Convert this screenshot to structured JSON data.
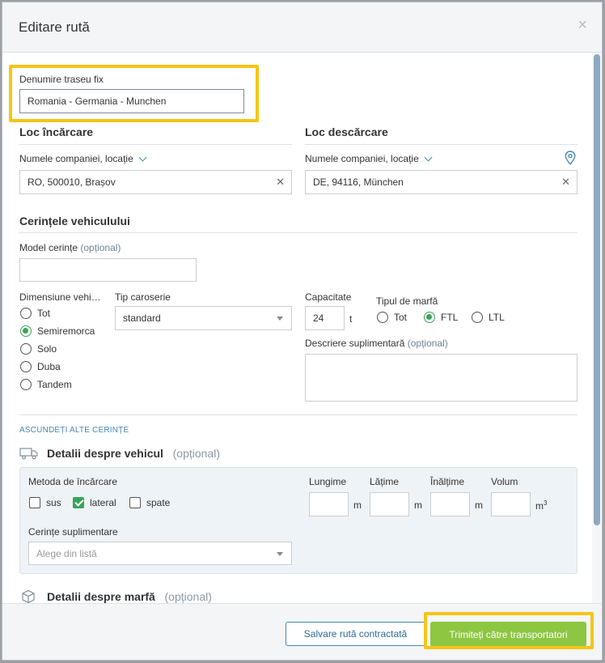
{
  "modal": {
    "title": "Editare rută",
    "close_label": "×"
  },
  "route_name": {
    "label": "Denumire traseu fix",
    "value": "Romania - Germania - Munchen"
  },
  "loading": {
    "title": "Loc încărcare",
    "dropdown_label": "Numele companiei, locație",
    "value": "RO, 500010, Brașov"
  },
  "unloading": {
    "title": "Loc descărcare",
    "dropdown_label": "Numele companiei, locație",
    "value": "DE, 94116, München"
  },
  "vehicle_requirements": {
    "title": "Cerințele vehiculului",
    "model_label": "Model cerințe",
    "model_optional": "(opțional)",
    "model_value": "",
    "dimension_label": "Dimensiune vehi…",
    "dimension_options": [
      "Tot",
      "Semiremorca",
      "Solo",
      "Duba",
      "Tandem"
    ],
    "dimension_selected": "Semiremorca",
    "body_label": "Tip caroserie",
    "body_value": "standard",
    "capacity_label": "Capacitate",
    "capacity_value": "24",
    "capacity_unit": "t",
    "cargo_type_label": "Tipul de marfă",
    "cargo_type_options": [
      "Tot",
      "FTL",
      "LTL"
    ],
    "cargo_type_selected": "FTL",
    "extra_desc_label": "Descriere suplimentară",
    "extra_desc_optional": "(opțional)",
    "extra_desc_value": ""
  },
  "hide_more_link": "ASCUNDEȚI ALTE CERINȚE",
  "vehicle_details": {
    "title": "Detalii despre vehicul",
    "optional": "(opțional)",
    "loading_method_label": "Metoda de încărcare",
    "loading_methods": [
      {
        "label": "sus",
        "checked": false
      },
      {
        "label": "lateral",
        "checked": true
      },
      {
        "label": "spate",
        "checked": false
      }
    ],
    "length_label": "Lungime",
    "width_label": "Lățime",
    "height_label": "Înălțime",
    "volume_label": "Volum",
    "unit_m": "m",
    "unit_m3": "m",
    "unit_m3_sup": "3",
    "extra_req_label": "Cerințe suplimentare",
    "extra_req_placeholder": "Alege din listă"
  },
  "cargo_details": {
    "title": "Detalii despre marfă",
    "optional": "(opțional)"
  },
  "footer": {
    "save_label": "Salvare rută contractată",
    "send_label": "Trimiteți către transportatori"
  },
  "colors": {
    "highlight": "#f5c518",
    "primary_green": "#8dc641",
    "check_green": "#3aa35a",
    "link_blue": "#4a86b0"
  }
}
